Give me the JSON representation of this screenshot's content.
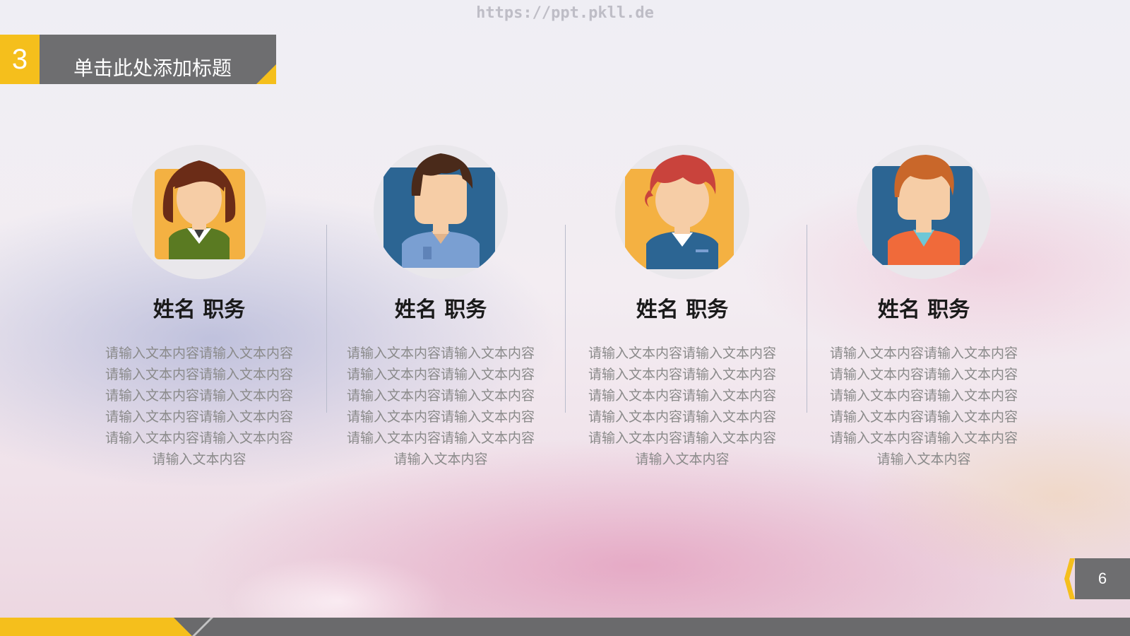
{
  "watermark": "https://ppt.pkll.de",
  "header": {
    "number": "3",
    "title": "单击此处添加标题"
  },
  "team": [
    {
      "name": "姓名  职务",
      "avatar_icon": "female-avatar-icon",
      "description": "请输入文本内容请输入文本内容\n请输入文本内容请输入文本内容\n请输入文本内容请输入文本内容\n请输入文本内容请输入文本内容\n请输入文本内容请输入文本内容\n请输入文本内容"
    },
    {
      "name": "姓名  职务",
      "avatar_icon": "male-avatar-icon",
      "description": "请输入文本内容请输入文本内容\n请输入文本内容请输入文本内容\n请输入文本内容请输入文本内容\n请输入文本内容请输入文本内容\n请输入文本内容请输入文本内容\n请输入文本内容"
    },
    {
      "name": "姓名  职务",
      "avatar_icon": "female-avatar-icon",
      "description": "请输入文本内容请输入文本内容\n请输入文本内容请输入文本内容\n请输入文本内容请输入文本内容\n请输入文本内容请输入文本内容\n请输入文本内容请输入文本内容\n请输入文本内容"
    },
    {
      "name": "姓名  职务",
      "avatar_icon": "male-avatar-icon",
      "description": "请输入文本内容请输入文本内容\n请输入文本内容请输入文本内容\n请输入文本内容请输入文本内容\n请输入文本内容请输入文本内容\n请输入文本内容请输入文本内容\n请输入文本内容"
    }
  ],
  "footer": {
    "page_number": "6"
  },
  "colors": {
    "accent": "#f5bf1c",
    "bar_gray": "#6e6e70"
  }
}
